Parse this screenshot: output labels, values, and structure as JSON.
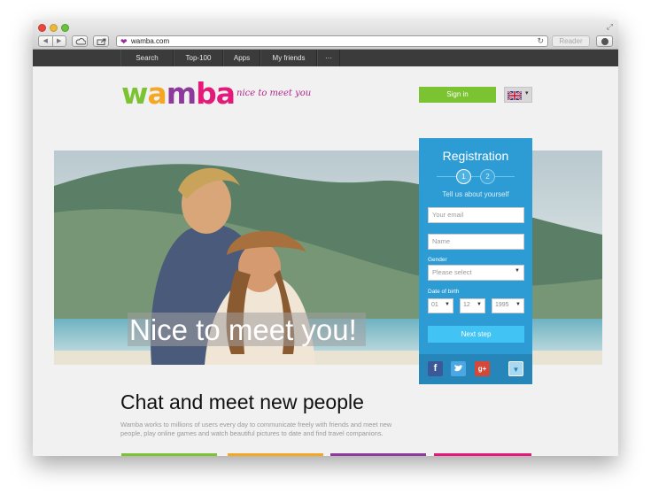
{
  "browser": {
    "url": "wamba.com",
    "reader_label": "Reader"
  },
  "nav": {
    "items": [
      "Search",
      "Top-100",
      "Apps",
      "My friends",
      "···"
    ]
  },
  "header": {
    "logo": {
      "w": "w",
      "a": "a",
      "m": "m",
      "b": "b",
      "a2": "a"
    },
    "tagline": "nice to meet you",
    "signin_label": "Sign in",
    "language_icon": "uk-flag-icon"
  },
  "hero": {
    "caption": "Nice to meet you!"
  },
  "registration": {
    "title": "Registration",
    "step1": "1",
    "step2": "2",
    "subtitle": "Tell us about yourself",
    "email_placeholder": "Your email",
    "name_placeholder": "Name",
    "gender_label": "Gender",
    "gender_value": "Please select",
    "dob_label": "Date of birth",
    "dob_day": "01",
    "dob_month": "12",
    "dob_year": "1995",
    "next_label": "Next step",
    "social": [
      "facebook-icon",
      "twitter-icon",
      "google-plus-icon"
    ]
  },
  "main": {
    "heading": "Chat and meet new people",
    "description": "Wamba works to millions of users every day to communicate freely with friends and meet new people, play online games and watch beautiful pictures to date and find travel companions."
  },
  "colors": {
    "green": "#7cc332",
    "orange": "#f5a623",
    "purple": "#8e3a9d",
    "pink": "#e5197a",
    "reg_blue": "#2e9cd4"
  }
}
